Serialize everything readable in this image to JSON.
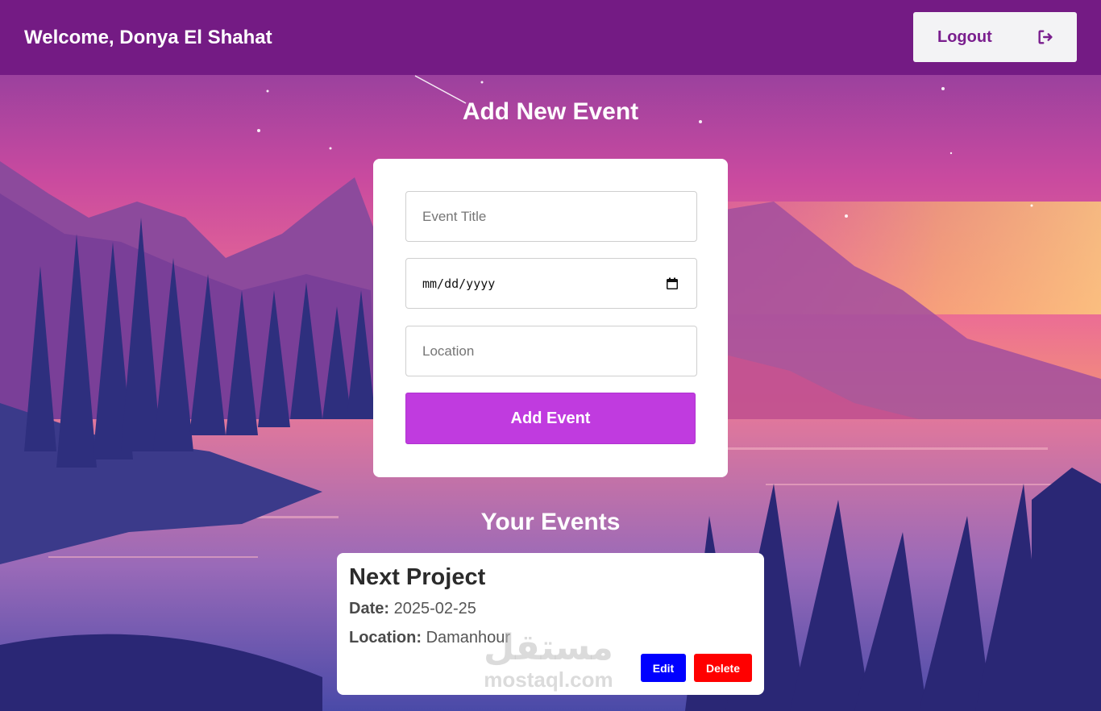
{
  "header": {
    "welcome_text": "Welcome, Donya El Shahat",
    "logout_label": "Logout",
    "logout_icon": "sign-out-icon"
  },
  "form_section": {
    "title": "Add New Event",
    "title_placeholder": "Event Title",
    "date_placeholder": "mm/dd/yyyy",
    "date_icon": "calendar-icon",
    "location_placeholder": "Location",
    "submit_label": "Add Event"
  },
  "events_section": {
    "title": "Your Events",
    "events": [
      {
        "title": "Next Project",
        "date_label": "Date:",
        "date": "2025-02-25",
        "location_label": "Location:",
        "location": "Damanhour",
        "edit_label": "Edit",
        "delete_label": "Delete"
      }
    ]
  },
  "watermark": {
    "arabic": "مستقل",
    "latin": "mostaql.com"
  },
  "colors": {
    "header": "#741b84",
    "logout_text": "#7a1e8e",
    "submit": "#c03bdf",
    "edit": "#0000ff",
    "delete": "#ff0000"
  }
}
